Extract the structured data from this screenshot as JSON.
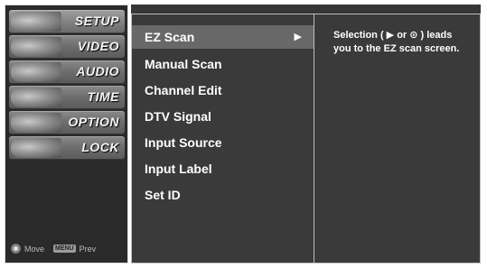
{
  "sidebar": {
    "items": [
      {
        "label": "SETUP",
        "icon": "setup-icon"
      },
      {
        "label": "VIDEO",
        "icon": "video-icon"
      },
      {
        "label": "AUDIO",
        "icon": "audio-icon"
      },
      {
        "label": "TIME",
        "icon": "time-icon"
      },
      {
        "label": "OPTION",
        "icon": "option-icon"
      },
      {
        "label": "LOCK",
        "icon": "lock-icon"
      }
    ],
    "footer": {
      "move_label": "Move",
      "menu_key": "MENU",
      "prev_label": "Prev"
    }
  },
  "menu": {
    "items": [
      {
        "label": "EZ Scan",
        "arrow": "▶"
      },
      {
        "label": "Manual Scan"
      },
      {
        "label": "Channel Edit"
      },
      {
        "label": "DTV Signal"
      },
      {
        "label": "Input Source"
      },
      {
        "label": "Input Label"
      },
      {
        "label": "Set ID"
      }
    ]
  },
  "help": {
    "text": "Selection ( ▶ or ⊙ ) leads you to the EZ scan screen."
  }
}
